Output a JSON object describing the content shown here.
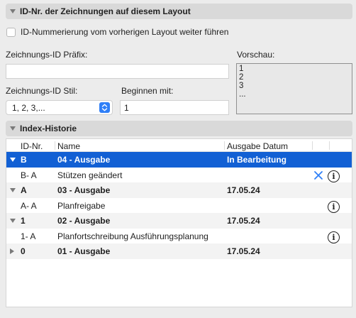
{
  "section1": {
    "title": "ID-Nr. der Zeichnungen auf diesem Layout"
  },
  "checkbox": {
    "label": "ID-Nummerierung vom vorherigen Layout weiter führen",
    "checked": false
  },
  "prefix": {
    "label": "Zeichnungs-ID Präfix:",
    "value": ""
  },
  "preview": {
    "label": "Vorschau:",
    "lines": [
      "1",
      "2",
      "3",
      "..."
    ]
  },
  "style": {
    "label": "Zeichnungs-ID Stil:",
    "value": "1, 2, 3,..."
  },
  "start": {
    "label": "Beginnen mit:",
    "value": "1"
  },
  "section2": {
    "title": "Index-Historie"
  },
  "table": {
    "headers": {
      "id": "ID-Nr.",
      "name": "Name",
      "date": "Ausgabe Datum"
    },
    "rows": [
      {
        "id": "B",
        "name": "04 - Ausgabe",
        "date": "In Bearbeitung"
      },
      {
        "id": "B- A",
        "name": "Stützen geändert",
        "date": ""
      },
      {
        "id": "A",
        "name": "03 - Ausgabe",
        "date": "17.05.24"
      },
      {
        "id": "A- A",
        "name": "Planfreigabe",
        "date": ""
      },
      {
        "id": "1",
        "name": "02 - Ausgabe",
        "date": "17.05.24"
      },
      {
        "id": "1- A",
        "name": "Planfortschreibung Ausführungsplanung",
        "date": ""
      },
      {
        "id": "0",
        "name": "01 - Ausgabe",
        "date": "17.05.24"
      }
    ],
    "info_glyph": "i"
  },
  "colors": {
    "accent": "#2f7ff7",
    "selection": "#1260d4"
  }
}
